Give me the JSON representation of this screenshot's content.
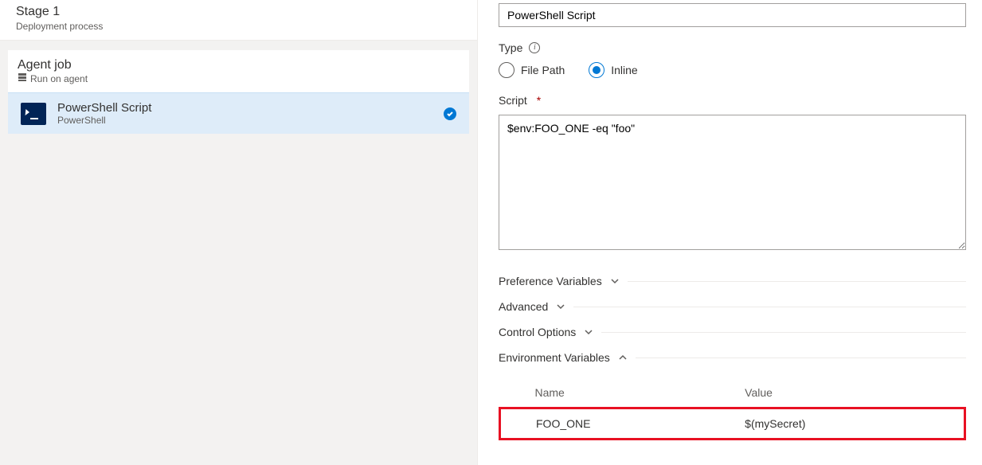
{
  "stage": {
    "title": "Stage 1",
    "subtitle": "Deployment process"
  },
  "agent_job": {
    "title": "Agent job",
    "subtitle": "Run on agent"
  },
  "task": {
    "title": "PowerShell Script",
    "subtitle": "PowerShell"
  },
  "form": {
    "display_name": "PowerShell Script",
    "type_label": "Type",
    "type_options": {
      "file_path": "File Path",
      "inline": "Inline"
    },
    "type_selected": "inline",
    "script_label": "Script",
    "script_value": "$env:FOO_ONE -eq \"foo\""
  },
  "sections": {
    "preference_variables": "Preference Variables",
    "advanced": "Advanced",
    "control_options": "Control Options",
    "environment_variables": "Environment Variables"
  },
  "env_table": {
    "columns": {
      "name": "Name",
      "value": "Value"
    },
    "rows": [
      {
        "name": "FOO_ONE",
        "value": "$(mySecret)"
      }
    ]
  }
}
